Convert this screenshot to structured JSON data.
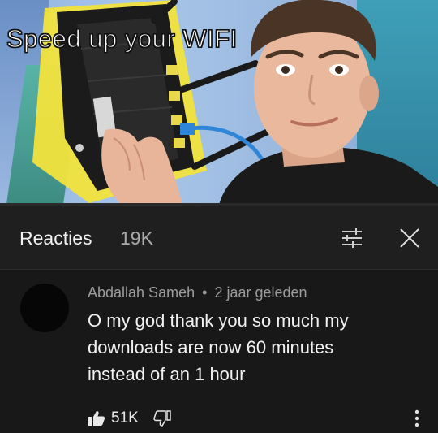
{
  "video": {
    "title_overlay": "Speed up your WIFI"
  },
  "comments_panel": {
    "title": "Reacties",
    "count": "19K",
    "filter_icon": "sliders-icon",
    "close_icon": "close-icon"
  },
  "comment": {
    "author": "Abdallah Sameh",
    "separator": "•",
    "time": "2 jaar geleden",
    "text": "O my god thank you so much my downloads are now 60 minutes instead of an 1 hour",
    "like_count": "51K",
    "like_icon": "thumbs-up-icon",
    "dislike_icon": "thumbs-down-icon",
    "more_icon": "more-vertical-icon"
  }
}
